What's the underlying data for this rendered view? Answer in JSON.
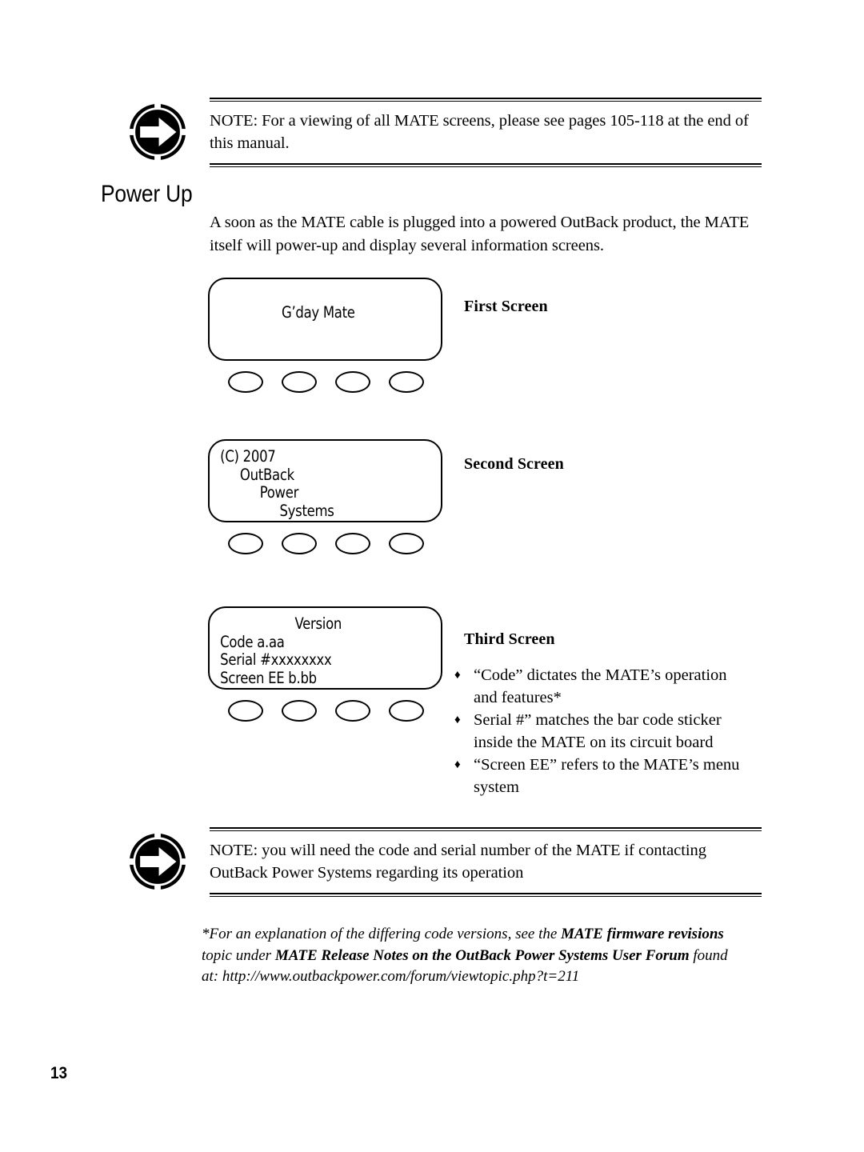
{
  "page": {
    "number": "13"
  },
  "notes": {
    "top": {
      "icon": "arrow-right-circle-icon",
      "text": "NOTE: For a viewing of all MATE screens, please see pages 105-118 at the end of this manual."
    },
    "bottom": {
      "icon": "arrow-right-circle-icon",
      "text": "NOTE: you will need the code and serial number of the MATE if contacting OutBack Power Systems regarding its operation"
    }
  },
  "section": {
    "heading": "Power Up",
    "intro": "A soon as the MATE cable is plugged into a powered OutBack product, the MATE itself will power-up and display several information screens."
  },
  "mate_screens": [
    {
      "label": "First Screen",
      "layout": "centered",
      "lines": [
        "G’day Mate"
      ],
      "buttons": [
        "mate-button-1",
        "mate-button-2",
        "mate-button-3",
        "mate-button-4"
      ]
    },
    {
      "label": "Second Screen",
      "layout": "staggered",
      "lines": [
        "(C) 2007",
        "     OutBack",
        "          Power",
        "               Systems"
      ],
      "buttons": [
        "mate-button-1",
        "mate-button-2",
        "mate-button-3",
        "mate-button-4"
      ]
    },
    {
      "label": "Third Screen",
      "layout": "version",
      "lines": [
        "Version",
        "Code a.aa",
        "Serial #xxxxxxxx",
        "Screen EE b.bb"
      ],
      "buttons": [
        "mate-button-1",
        "mate-button-2",
        "mate-button-3",
        "mate-button-4"
      ]
    }
  ],
  "bullets": [
    "“Code” dictates the MATE’s operation and features*",
    "Serial #” matches the bar code sticker inside the MATE on its circuit board",
    "“Screen EE” refers to the MATE’s menu system"
  ],
  "bullet_marker": "♦",
  "footnote": {
    "part1": "*For an explanation of the differing code versions, see the ",
    "bold1": "MATE firmware revisions",
    "part2": " topic under ",
    "bold2": "MATE Release Notes on the OutBack Power Systems User Forum",
    "part3": " found at: http://www.outbackpower.com/forum/viewtopic.php?t=211"
  },
  "colors": {
    "ink": "#000000",
    "paper": "#ffffff"
  }
}
